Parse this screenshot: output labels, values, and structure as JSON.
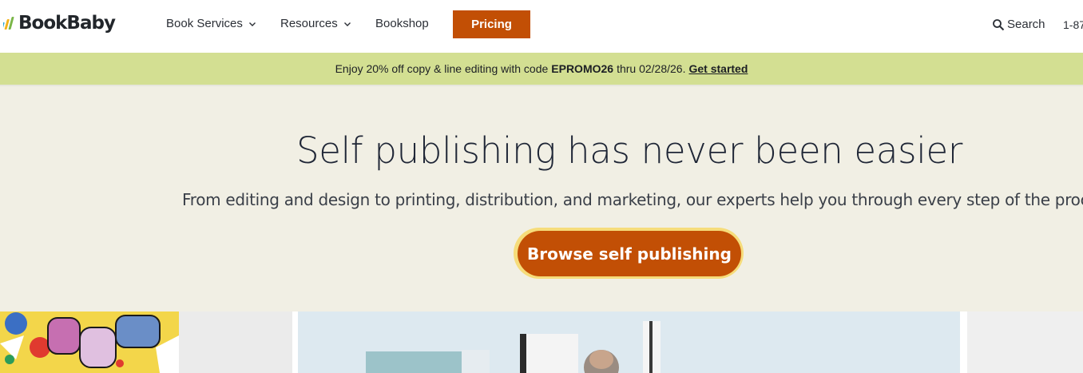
{
  "header": {
    "logo_text": "BookBaby",
    "nav": [
      {
        "label": "Book Services",
        "has_dropdown": true
      },
      {
        "label": "Resources",
        "has_dropdown": true
      },
      {
        "label": "Bookshop",
        "has_dropdown": false
      }
    ],
    "pricing_label": "Pricing",
    "search_label": "Search",
    "phone_partial": "1-87"
  },
  "promo": {
    "text_before": "Enjoy 20% off copy & line editing with code",
    "code": "EPROMO26",
    "text_after": "thru 02/28/26.",
    "link_label": "Get started"
  },
  "hero": {
    "title": "Self publishing has never been easier",
    "subtitle": "From editing and design to printing, distribution, and marketing, our experts help you through every step of the process.",
    "cta_label": "Browse self publishing"
  },
  "colors": {
    "accent": "#c24f05",
    "promo_bg": "#d3df92",
    "hero_bg": "#f1efe4",
    "cta_ring": "#f6dc7a"
  },
  "icons": {
    "search": "search-icon",
    "chevron": "chevron-down-icon",
    "logo": "bookbaby-logo-mark"
  }
}
